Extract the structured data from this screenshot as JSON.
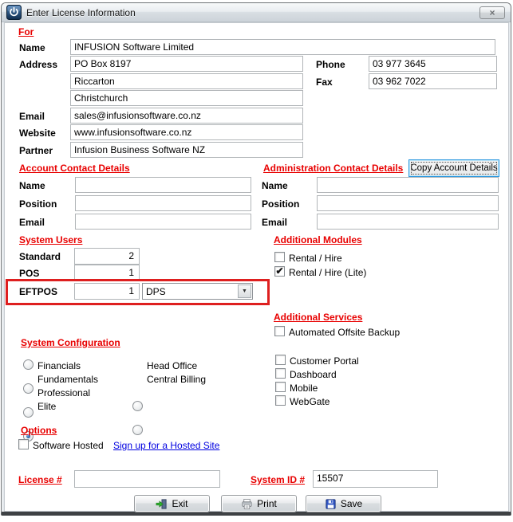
{
  "window": {
    "title": "Enter License Information",
    "close_glyph": "×"
  },
  "icons": {
    "dropdown_arrow": "▼"
  },
  "for_section": {
    "header": "For",
    "name": {
      "label": "Name",
      "value": "INFUSION Software Limited"
    },
    "address": {
      "label": "Address",
      "lines": [
        "PO Box 8197",
        "Riccarton",
        "Christchurch"
      ]
    },
    "phone": {
      "label": "Phone",
      "value": "03 977 3645"
    },
    "fax": {
      "label": "Fax",
      "value": "03 962 7022"
    },
    "email": {
      "label": "Email",
      "value": "sales@infusionsoftware.co.nz"
    },
    "website": {
      "label": "Website",
      "value": "www.infusionsoftware.co.nz"
    },
    "partner": {
      "label": "Partner",
      "value": "Infusion Business Software NZ"
    }
  },
  "account_contact": {
    "header": "Account Contact Details",
    "name": {
      "label": "Name",
      "value": ""
    },
    "position": {
      "label": "Position",
      "value": ""
    },
    "email": {
      "label": "Email",
      "value": ""
    }
  },
  "admin_contact": {
    "header": "Administration Contact Details",
    "copy_button_label": "Copy Account Details",
    "name": {
      "label": "Name",
      "value": ""
    },
    "position": {
      "label": "Position",
      "value": ""
    },
    "email": {
      "label": "Email",
      "value": ""
    }
  },
  "system_users": {
    "header": "System Users",
    "standard": {
      "label": "Standard",
      "value": "2"
    },
    "pos": {
      "label": "POS",
      "value": "1"
    },
    "eftpos": {
      "label": "EFTPOS",
      "value": "1",
      "provider": "DPS"
    }
  },
  "additional_modules": {
    "header": "Additional Modules",
    "items": [
      {
        "label": "Rental / Hire",
        "checked": false
      },
      {
        "label": "Rental / Hire (Lite)",
        "checked": true
      }
    ]
  },
  "additional_services": {
    "header": "Additional Services",
    "backup": {
      "label": "Automated Offsite Backup",
      "checked": false
    },
    "items": [
      {
        "label": "Customer Portal",
        "checked": false
      },
      {
        "label": "Dashboard",
        "checked": false
      },
      {
        "label": "Mobile",
        "checked": false
      },
      {
        "label": "WebGate",
        "checked": false
      }
    ]
  },
  "system_configuration": {
    "header": "System Configuration",
    "left_options": [
      {
        "label": "Financials",
        "selected": false
      },
      {
        "label": "Fundamentals",
        "selected": false
      },
      {
        "label": "Professional",
        "selected": false
      },
      {
        "label": "Elite",
        "selected": true
      }
    ],
    "right_options": [
      {
        "label": "Head Office",
        "selected": false
      },
      {
        "label": "Central Billing",
        "selected": false
      }
    ]
  },
  "options_section": {
    "header": "Options",
    "software_hosted": {
      "label": "Software Hosted",
      "checked": false
    },
    "hosted_link_label": "Sign up for a Hosted Site"
  },
  "footer": {
    "license": {
      "label": "License #",
      "value": ""
    },
    "system_id": {
      "label": "System ID #",
      "value": "15507"
    }
  },
  "action_buttons": {
    "exit": "Exit",
    "print": "Print",
    "save": "Save"
  },
  "colors": {
    "section_header_red": "#e80000",
    "highlight_red": "#de1f1f",
    "link_blue": "#0000e0"
  }
}
